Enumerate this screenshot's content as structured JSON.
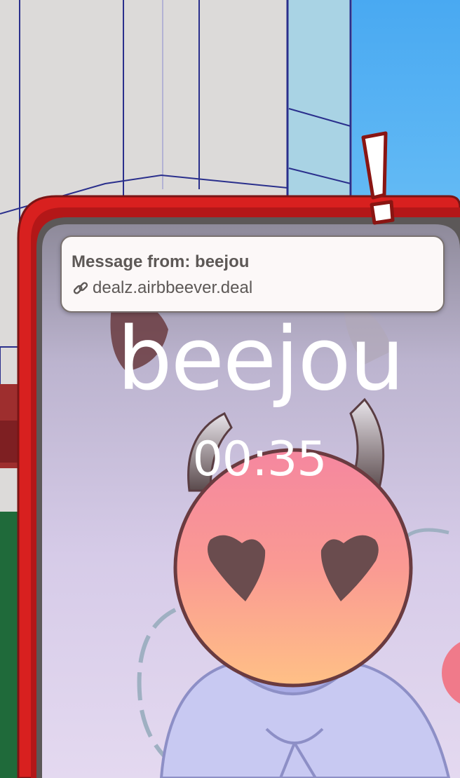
{
  "notification": {
    "title": "Message from: beejou",
    "link": "dealz.airbbeever.deal",
    "link_icon": "link-icon"
  },
  "call": {
    "caller_name": "beejou",
    "timer": "00:35"
  },
  "colors": {
    "phone_frame": "#d8201f",
    "sky": "#56b4f0",
    "building": "#dedbda",
    "screen_bg": "#d8cbe8",
    "face_top": "#f58aa2",
    "face_bottom": "#ffbd84",
    "hoodie": "#c8c9f2",
    "notification_bg": "#fcf8f8",
    "notification_text": "#5d5856",
    "alert_mark": "#ffffff"
  }
}
